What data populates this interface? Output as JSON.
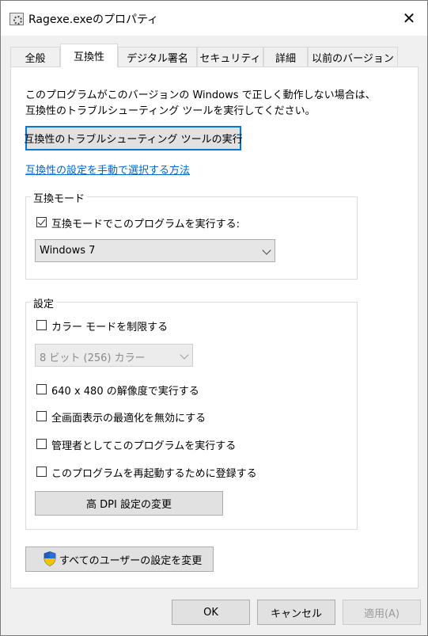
{
  "window": {
    "title": "Ragexe.exeのプロパティ",
    "close_label": "✕"
  },
  "tabs": [
    {
      "label": "全般"
    },
    {
      "label": "互換性"
    },
    {
      "label": "デジタル署名"
    },
    {
      "label": "セキュリティ"
    },
    {
      "label": "詳細"
    },
    {
      "label": "以前のバージョン"
    }
  ],
  "active_tab": "互換性",
  "intro": {
    "line1": "このプログラムがこのバージョンの Windows で正しく動作しない場合は、",
    "line2": "互換性のトラブルシューティング ツールを実行してください。"
  },
  "troubleshoot_button": "互換性のトラブルシューティング ツールの実行",
  "manual_link": "互換性の設定を手動で選択する方法",
  "compat_mode": {
    "group_title": "互換モード",
    "checkbox_label": "互換モードでこのプログラムを実行する:",
    "checked": true,
    "selected_os": "Windows 7"
  },
  "settings": {
    "group_title": "設定",
    "reduced_color_label": "カラー モードを制限する",
    "color_select": "8 ビット (256) カラー",
    "res_640_label": "640 x 480 の解像度で実行する",
    "fullscreen_opt_label": "全画面表示の最適化を無効にする",
    "admin_label": "管理者としてこのプログラムを実行する",
    "restart_label": "このプログラムを再起動するために登録する",
    "dpi_button": "高 DPI 設定の変更"
  },
  "all_users_button": "すべてのユーザーの設定を変更",
  "footer": {
    "ok": "OK",
    "cancel": "キャンセル",
    "apply": "適用(A)"
  }
}
